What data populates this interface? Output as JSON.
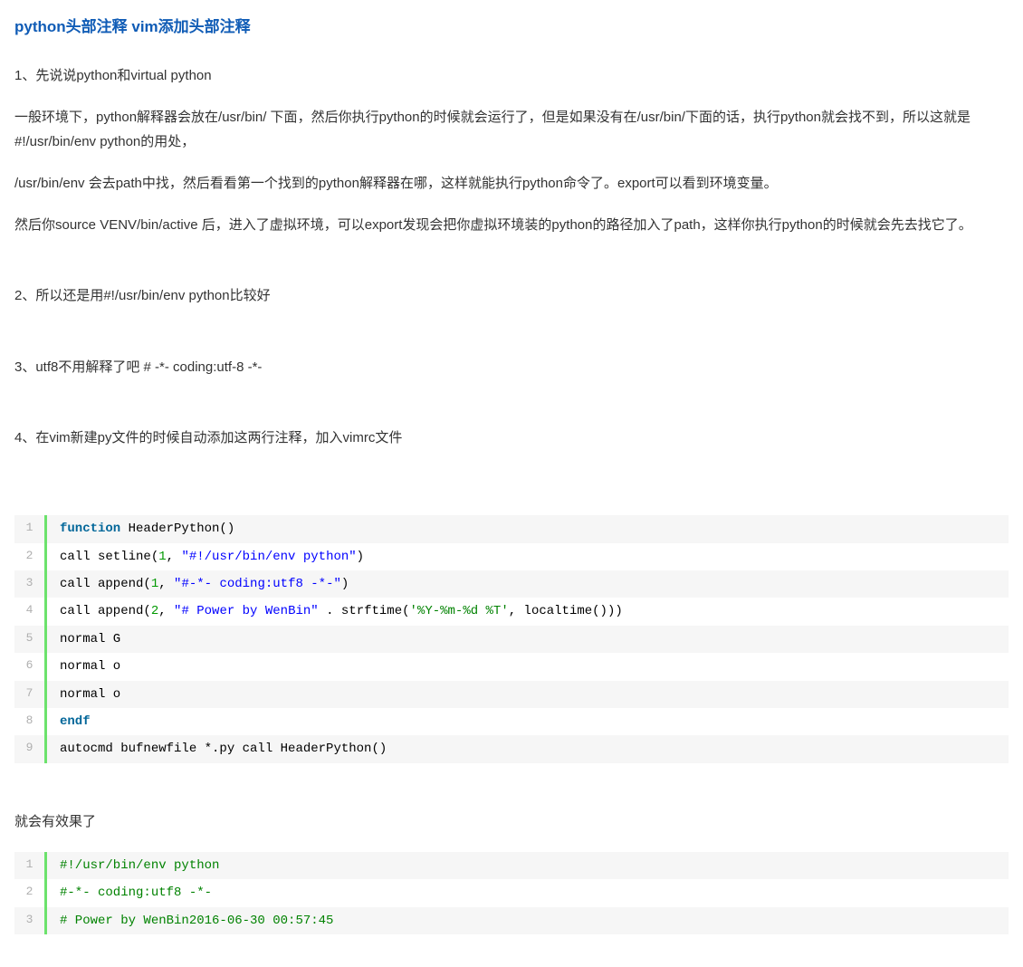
{
  "title": "python头部注释 vim添加头部注释",
  "paragraphs": {
    "p1": "1、先说说python和virtual python",
    "p2": "一般环境下，python解释器会放在/usr/bin/ 下面，然后你执行python的时候就会运行了，但是如果没有在/usr/bin/下面的话，执行python就会找不到，所以这就是#!/usr/bin/env python的用处，",
    "p3": "/usr/bin/env 会去path中找，然后看看第一个找到的python解释器在哪，这样就能执行python命令了。export可以看到环境变量。",
    "p4": "然后你source VENV/bin/active 后，进入了虚拟环境，可以export发现会把你虚拟环境装的python的路径加入了path，这样你执行python的时候就会先去找它了。",
    "p5": "2、所以还是用#!/usr/bin/env python比较好",
    "p6": "3、utf8不用解释了吧   # -*- coding:utf-8 -*-",
    "p7": "4、在vim新建py文件的时候自动添加这两行注释，加入vimrc文件",
    "p8": "就会有效果了"
  },
  "code1": {
    "lines": [
      {
        "num": "1",
        "tokens": [
          {
            "t": "function",
            "c": "kw"
          },
          {
            "t": " HeaderPython()",
            "c": "plain"
          }
        ]
      },
      {
        "num": "2",
        "tokens": [
          {
            "t": "call setline(",
            "c": "plain"
          },
          {
            "t": "1",
            "c": "num"
          },
          {
            "t": ", ",
            "c": "plain"
          },
          {
            "t": "\"#!/usr/bin/env python\"",
            "c": "str"
          },
          {
            "t": ")",
            "c": "plain"
          }
        ]
      },
      {
        "num": "3",
        "tokens": [
          {
            "t": "call append(",
            "c": "plain"
          },
          {
            "t": "1",
            "c": "num"
          },
          {
            "t": ", ",
            "c": "plain"
          },
          {
            "t": "\"#-*- coding:utf8 -*-\"",
            "c": "str"
          },
          {
            "t": ")",
            "c": "plain"
          }
        ]
      },
      {
        "num": "4",
        "tokens": [
          {
            "t": "call append(",
            "c": "plain"
          },
          {
            "t": "2",
            "c": "num"
          },
          {
            "t": ", ",
            "c": "plain"
          },
          {
            "t": "\"# Power by WenBin\"",
            "c": "str"
          },
          {
            "t": " . strftime(",
            "c": "plain"
          },
          {
            "t": "'%Y-%m-%d %T'",
            "c": "str2"
          },
          {
            "t": ", localtime()))",
            "c": "plain"
          }
        ]
      },
      {
        "num": "5",
        "tokens": [
          {
            "t": "normal G",
            "c": "plain"
          }
        ]
      },
      {
        "num": "6",
        "tokens": [
          {
            "t": "normal o",
            "c": "plain"
          }
        ]
      },
      {
        "num": "7",
        "tokens": [
          {
            "t": "normal o",
            "c": "plain"
          }
        ]
      },
      {
        "num": "8",
        "tokens": [
          {
            "t": "endf",
            "c": "kw"
          }
        ]
      },
      {
        "num": "9",
        "tokens": [
          {
            "t": "autocmd bufnewfile *.py call HeaderPython()",
            "c": "plain"
          }
        ]
      }
    ]
  },
  "code2": {
    "lines": [
      {
        "num": "1",
        "tokens": [
          {
            "t": "#!/usr/bin/env python",
            "c": "comment"
          }
        ]
      },
      {
        "num": "2",
        "tokens": [
          {
            "t": "#-*- coding:utf8 -*-",
            "c": "comment"
          }
        ]
      },
      {
        "num": "3",
        "tokens": [
          {
            "t": "# Power by WenBin2016-06-30 00:57:45",
            "c": "comment"
          }
        ]
      }
    ]
  }
}
